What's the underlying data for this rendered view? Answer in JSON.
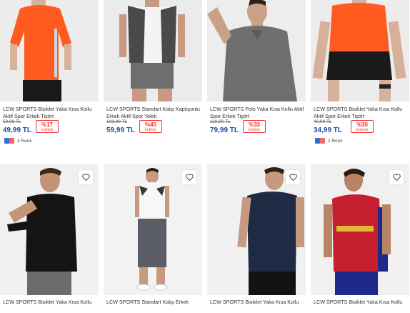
{
  "icons": {
    "favorite": "heart-outline-icon"
  },
  "products": [
    {
      "title": "LCW SPORTS Bisiklet Yaka Kısa Kollu Aktif Spor Erkek Tişört",
      "old_price": "59,99 TL",
      "price": "49,99 TL",
      "discount": "%17",
      "discount_label": "İndirim",
      "colors_text": "3 Renk",
      "colors": [
        "#2f6fd6",
        "#f06a6a"
      ]
    },
    {
      "title": "LCW SPORTS Standart Kalıp Kapüşonlu Erkek Aktif Spor Yelek",
      "old_price": "109,99 TL",
      "price": "59,99 TL",
      "discount": "%45",
      "discount_label": "İndirim"
    },
    {
      "title": "LCW SPORTS Polo Yaka Kısa Kollu Aktif Spor Erkek Tişört",
      "old_price": "119,99 TL",
      "price": "79,99 TL",
      "discount": "%33",
      "discount_label": "İndirim"
    },
    {
      "title": "LCW SPORTS Bisiklet Yaka Kısa Kollu Aktif Spor Erkek Tişört",
      "old_price": "49,99 TL",
      "price": "34,99 TL",
      "discount": "%30",
      "discount_label": "İndirim",
      "colors_text": "2 Renk",
      "colors": [
        "#2f6fd6",
        "#f06a6a"
      ]
    },
    {
      "title": "LCW SPORTS Bisiklet Yaka Kısa Kollu"
    },
    {
      "title": "LCW SPORTS Standart Kalıp Erkek"
    },
    {
      "title": "LCW SPORTS Bisiklet Yaka Kısa Kollu"
    },
    {
      "title": "LCW SPORTS Bisiklet Yaka Kısa Kollu"
    }
  ]
}
